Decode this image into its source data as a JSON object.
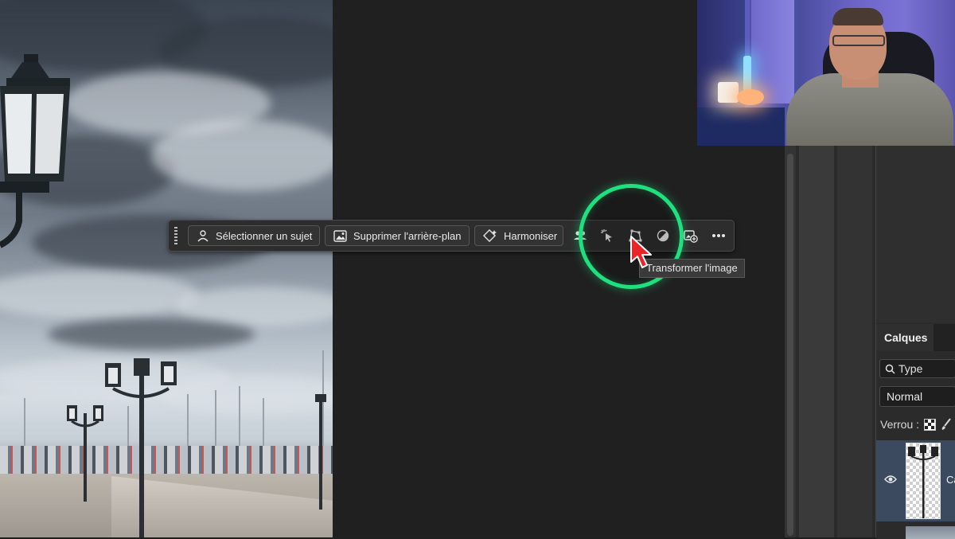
{
  "toolbar": {
    "select_subject_label": "Sélectionner un sujet",
    "remove_background_label": "Supprimer l'arrière-plan",
    "harmonize_label": "Harmoniser"
  },
  "tooltip": {
    "text": "Transformer l'image"
  },
  "layers_panel": {
    "tab_label": "Calques",
    "filter_label": "Type",
    "blend_mode": "Normal",
    "lock_label": "Verrou :",
    "layer_name": "Ca"
  },
  "colors": {
    "highlight_ring": "#1fe07e",
    "cursor": "#e8262a",
    "selected_layer": "#3b4a5e"
  },
  "icons": [
    "subject-icon",
    "image-remove-bg-icon",
    "harmonize-icon",
    "people-icon",
    "magic-cursor-icon",
    "transform-image-icon",
    "adjustment-circle-icon",
    "add-image-icon",
    "more-icon",
    "search-icon",
    "lock-transparency-icon",
    "brush-icon",
    "eye-icon"
  ]
}
